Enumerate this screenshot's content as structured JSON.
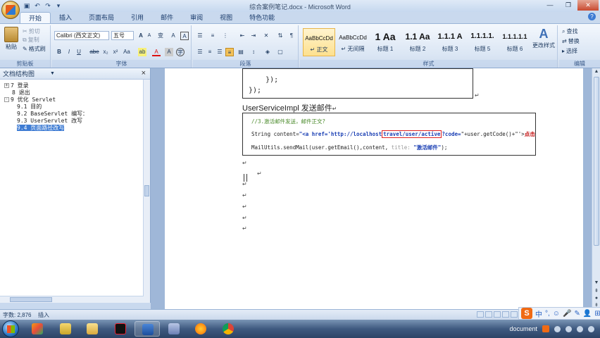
{
  "window": {
    "title": "综合案例笔记.docx - Microsoft Word"
  },
  "ribbon": {
    "tabs": [
      "开始",
      "插入",
      "页面布局",
      "引用",
      "邮件",
      "审阅",
      "视图",
      "特色功能"
    ],
    "active_tab": "开始",
    "clipboard": {
      "paste": "粘贴",
      "cut": "剪切",
      "copy": "复制",
      "format_painter": "格式刷",
      "label": "剪贴板"
    },
    "font": {
      "font_name": "Calibri (西文正文)",
      "font_size": "五号",
      "label": "字体",
      "bold": "B",
      "italic": "I",
      "underline": "U",
      "strike": "abe",
      "subscript": "x₂",
      "superscript": "x²",
      "change_case": "Aa",
      "font_color": "A",
      "grow": "A",
      "shrink": "A",
      "clear": "A",
      "wen": "变",
      "border_char": "A",
      "highlight": "ab",
      "shade": "A",
      "enclose": "字"
    },
    "paragraph": {
      "label": "段落"
    },
    "styles": {
      "label": "样式",
      "items": [
        {
          "preview": "AaBbCcDd",
          "name": "↵ 正文",
          "selected": true
        },
        {
          "preview": "AaBbCcDd",
          "name": "↵ 无间隔",
          "selected": false
        },
        {
          "preview": "1 Aa",
          "name": "标题 1",
          "selected": false
        },
        {
          "preview": "1.1 Aa",
          "name": "标题 2",
          "selected": false
        },
        {
          "preview": "1.1.1 A",
          "name": "标题 3",
          "selected": false
        },
        {
          "preview": "1.1.1.1.",
          "name": "标题 5",
          "selected": false
        },
        {
          "preview": "1.1.1.1.1",
          "name": "标题 6",
          "selected": false
        }
      ],
      "change_styles": "更改样式"
    },
    "editing": {
      "label": "编辑",
      "find": "查找",
      "replace": "替换",
      "select": "选择"
    }
  },
  "nav_pane": {
    "title": "文档结构图",
    "close": "×",
    "items": [
      {
        "text": "7 登录",
        "level": 1,
        "toggle": "+"
      },
      {
        "text": "8 退出",
        "level": 1,
        "toggle": ""
      },
      {
        "text": "9 优化 Servlet",
        "level": 1,
        "toggle": "-"
      },
      {
        "text": "9.1 目的",
        "level": 2
      },
      {
        "text": "9.2 BaseServlet 编写：",
        "level": 2
      },
      {
        "text": "9.3 UserServlet 改写",
        "level": 2
      },
      {
        "text": "9.4 页面路径改写",
        "level": 2,
        "selected": true
      }
    ]
  },
  "document": {
    "code_block_1": [
      "    });",
      "});"
    ],
    "heading": "UserServiceImpl 发送邮件",
    "code_block_2": {
      "comment": "//3.激活邮件发送，邮件正文?",
      "line2_prefix": "String content=",
      "line2_str_a": "\"<a href='http://localhost",
      "line2_highlight": "travel/user/active",
      "line2_str_b": "?code=",
      "line2_rest": "\"+user.getCode()+\"'>",
      "line2_tail": "点击激",
      "line3_prefix": "MailUtils.sendMail(user.getEmail(),content, ",
      "line3_hint": "title: ",
      "line3_str": "\"激活邮件\"",
      "line3_end": ");"
    },
    "para_mark": "↵"
  },
  "status_bar": {
    "word_count": "字数: 2,876",
    "insert_mode": "插入"
  },
  "ime": {
    "logo": "S",
    "lang": "中"
  },
  "taskbar": {
    "tray_text": "document"
  }
}
